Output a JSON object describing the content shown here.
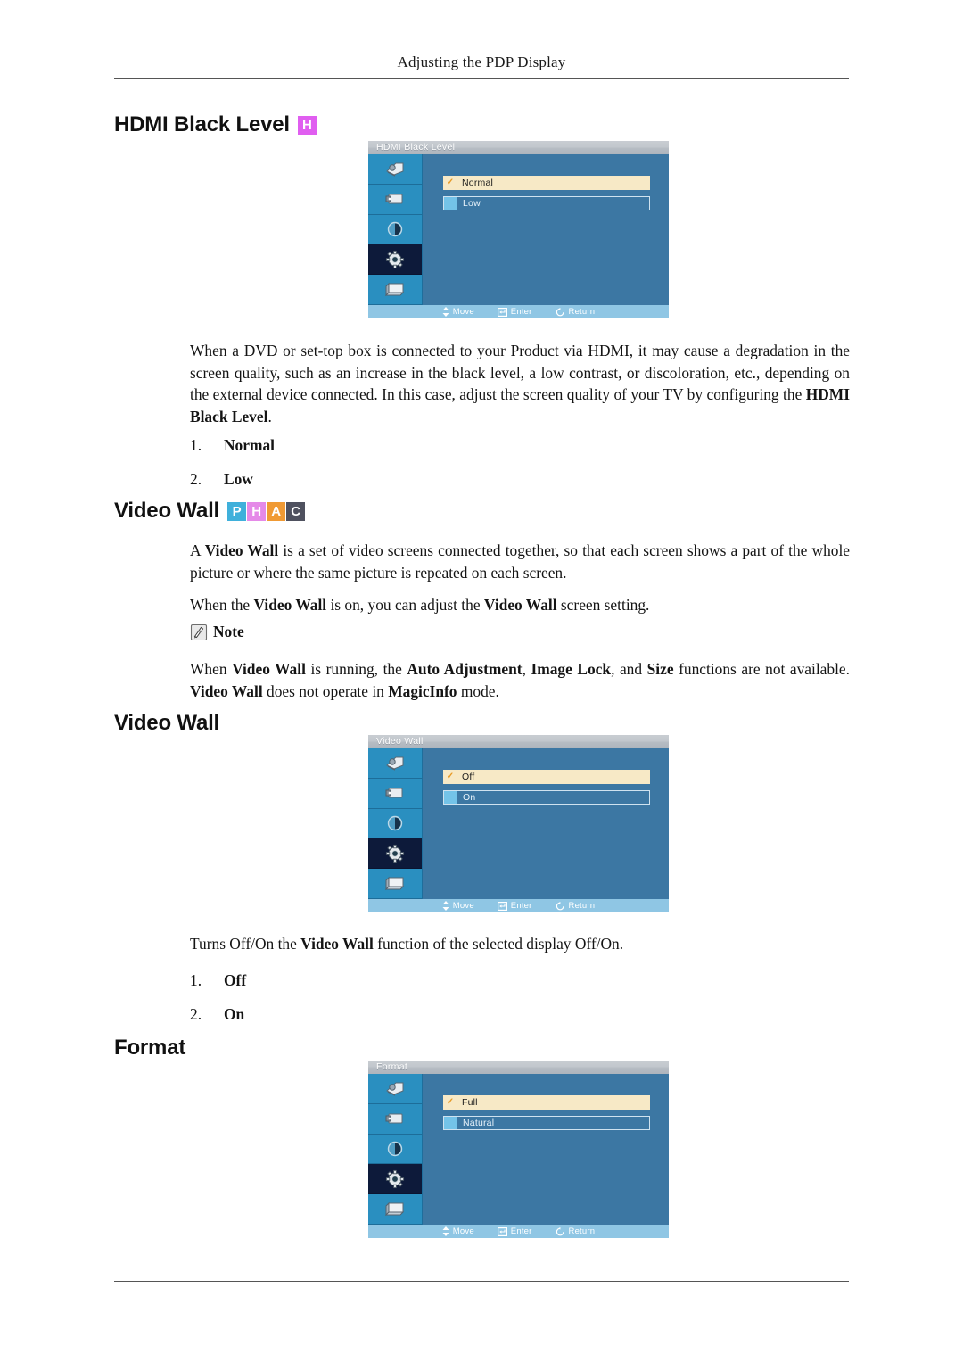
{
  "page": {
    "running_header": "Adjusting the PDP Display"
  },
  "sections": [
    {
      "heading": "HDMI Black Level",
      "badges": [
        {
          "letter": "H",
          "color": "#e05ef0"
        }
      ]
    },
    {
      "heading": "Video Wall",
      "badges": [
        {
          "letter": "P",
          "color": "#3fb0db"
        },
        {
          "letter": "H",
          "color": "#e58ae8"
        },
        {
          "letter": "A",
          "color": "#f09a34"
        },
        {
          "letter": "C",
          "color": "#4f515f"
        }
      ]
    },
    {
      "heading": "Video Wall",
      "badges": []
    },
    {
      "heading": "Format",
      "badges": []
    }
  ],
  "osd_hdmi_black_level": {
    "title": "HDMI Black Level",
    "options": [
      {
        "label": "Normal",
        "selected": true
      },
      {
        "label": "Low",
        "selected": false
      }
    ],
    "hints": [
      {
        "icon": "move-icon",
        "label": "Move"
      },
      {
        "icon": "enter-icon",
        "label": "Enter"
      },
      {
        "icon": "return-icon",
        "label": "Return"
      }
    ],
    "sidebar_icons": [
      "picture-icon",
      "sound-icon",
      "input-icon",
      "setup-gear-icon",
      "multi-control-icon"
    ],
    "selected_sidebar_index": 3
  },
  "osd_video_wall": {
    "title": "Video Wall",
    "options": [
      {
        "label": "Off",
        "selected": true
      },
      {
        "label": "On",
        "selected": false
      }
    ],
    "hints": [
      {
        "icon": "move-icon",
        "label": "Move"
      },
      {
        "icon": "enter-icon",
        "label": "Enter"
      },
      {
        "icon": "return-icon",
        "label": "Return"
      }
    ],
    "sidebar_icons": [
      "picture-icon",
      "sound-icon",
      "input-icon",
      "setup-gear-icon",
      "multi-control-icon"
    ],
    "selected_sidebar_index": 3
  },
  "osd_format": {
    "title": "Format",
    "options": [
      {
        "label": "Full",
        "selected": true
      },
      {
        "label": "Natural",
        "selected": false
      }
    ],
    "hints": [
      {
        "icon": "move-icon",
        "label": "Move"
      },
      {
        "icon": "enter-icon",
        "label": "Enter"
      },
      {
        "icon": "return-icon",
        "label": "Return"
      }
    ],
    "sidebar_icons": [
      "picture-icon",
      "sound-icon",
      "input-icon",
      "setup-gear-icon",
      "multi-control-icon"
    ],
    "selected_sidebar_index": 3
  },
  "body": {
    "hdmi_paragraph_plain": "When a DVD or set-top box is connected to your Product via HDMI, it may cause a degradation in the screen quality, such as an increase in the black level, a low contrast, or discoloration, etc., depending on the external device connected. In this case, adjust the screen quality of your TV by configuring the HDMI Black Level.",
    "hdmi_paragraph_html": "When a DVD or set-top box is connected to your Product via HDMI, it may cause a degradation in the screen quality, such as an increase in the black level, a low contrast, or discoloration, etc., depending on the external device connected. In this case, adjust the screen quality of your TV by configuring the <b>HDMI Black Level</b>.",
    "hdmi_options": [
      {
        "num": "1.",
        "value": "Normal"
      },
      {
        "num": "2.",
        "value": "Low"
      }
    ],
    "videowall_intro_html": "A <b>Video Wall</b> is a set of video screens connected together, so that each screen shows a part of the whole picture or where the same picture is repeated on each screen.",
    "videowall_intro_plain": "A Video Wall is a set of video screens connected together, so that each screen shows a part of the whole picture or where the same picture is repeated on each screen.",
    "videowall_second_html": "When the <b>Video Wall</b> is on, you can adjust the <b>Video Wall</b> screen setting.",
    "videowall_second_plain": "When the Video Wall is on, you can adjust the Video Wall screen setting.",
    "note_label": "Note",
    "note_body_html": "When <b>Video Wall</b> is running, the <b>Auto Adjustment</b>, <b>Image Lock</b>, and <b>Size</b> functions are not available. <b>Video Wall</b> does not operate in <b>MagicInfo</b> mode.",
    "note_body_plain": "When Video Wall is running, the Auto Adjustment, Image Lock, and Size functions are not available. Video Wall does not operate in MagicInfo mode.",
    "videowall_desc_html": "Turns Off/On the <b>Video Wall</b> function of the selected display Off/On.",
    "videowall_desc_plain": "Turns Off/On the Video Wall function of the selected display Off/On.",
    "videowall_options": [
      {
        "num": "1.",
        "value": "Off"
      },
      {
        "num": "2.",
        "value": "On"
      }
    ]
  }
}
